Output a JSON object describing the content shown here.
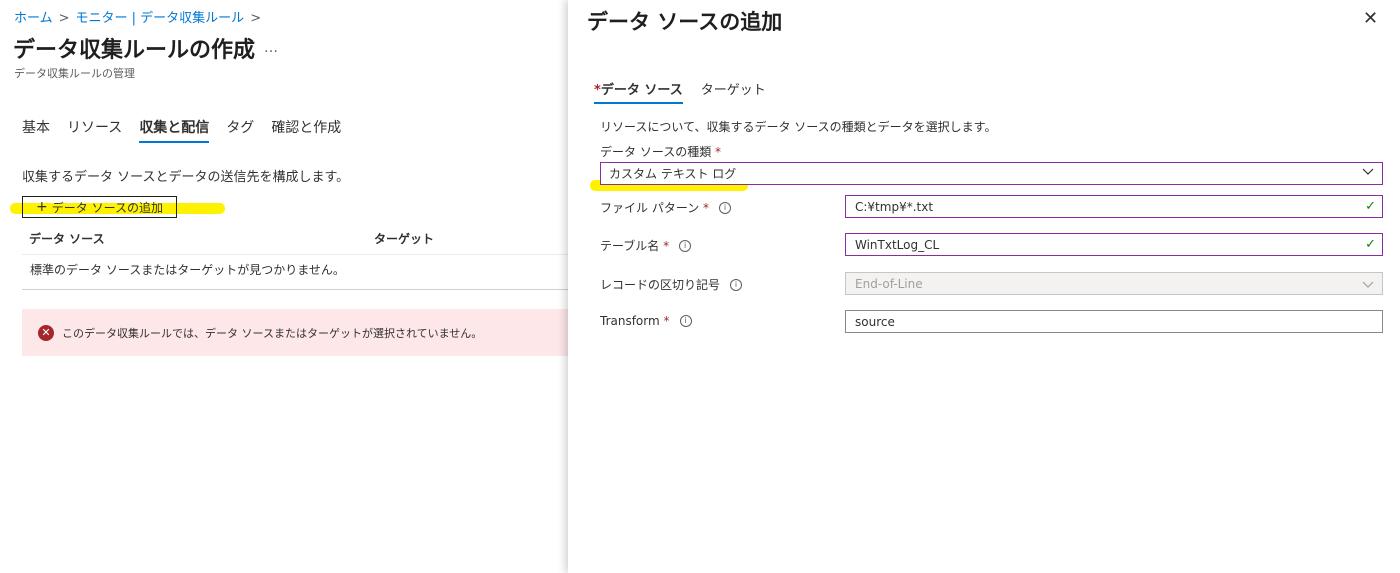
{
  "breadcrumb": {
    "home": "ホーム",
    "monitor": "モニター | データ収集ルール",
    "separator": ">"
  },
  "page": {
    "title": "データ収集ルールの作成",
    "more": "…",
    "subtitle": "データ収集ルールの管理"
  },
  "tabs": [
    "基本",
    "リソース",
    "収集と配信",
    "タグ",
    "確認と作成"
  ],
  "active_tab": "収集と配信",
  "main": {
    "description": "収集するデータ ソースとデータの送信先を構成します。",
    "add_button_icon": "+",
    "add_button": "データ ソースの追加",
    "table": {
      "columns": [
        "データ ソース",
        "ターゲット"
      ],
      "empty_message": "標準のデータ ソースまたはターゲットが見つかりません。"
    },
    "error": {
      "icon": "✕",
      "message": "このデータ収集ルールでは、データ ソースまたはターゲットが選択されていません。"
    }
  },
  "panel": {
    "title": "データ ソースの追加",
    "close": "✕",
    "tabs": [
      {
        "label": "データ ソース",
        "required": "*"
      },
      {
        "label": "ターゲット"
      }
    ],
    "description": "リソースについて、収集するデータ ソースの種類とデータを選択します。",
    "source_type": {
      "label": "データ ソースの種類",
      "required": "*",
      "value": "カスタム テキスト ログ"
    },
    "fields": [
      {
        "label": "ファイル パターン",
        "required": "*",
        "value": "C:¥tmp¥*.txt",
        "valid": true
      },
      {
        "label": "テーブル名",
        "required": "*",
        "value": "WinTxtLog_CL",
        "valid": true
      },
      {
        "label": "レコードの区切り記号",
        "required": "",
        "value": "End-of-Line",
        "disabled": true
      },
      {
        "label": "Transform",
        "required": "*",
        "value": "source"
      }
    ],
    "info_icon": "i",
    "check_icon": "✓"
  },
  "colors": {
    "accent": "#0078d4",
    "required": "#a4262c",
    "error_bg": "#fde7e9",
    "input_border": "#8a2da5",
    "highlight": "#fff200",
    "valid": "#107c10"
  }
}
